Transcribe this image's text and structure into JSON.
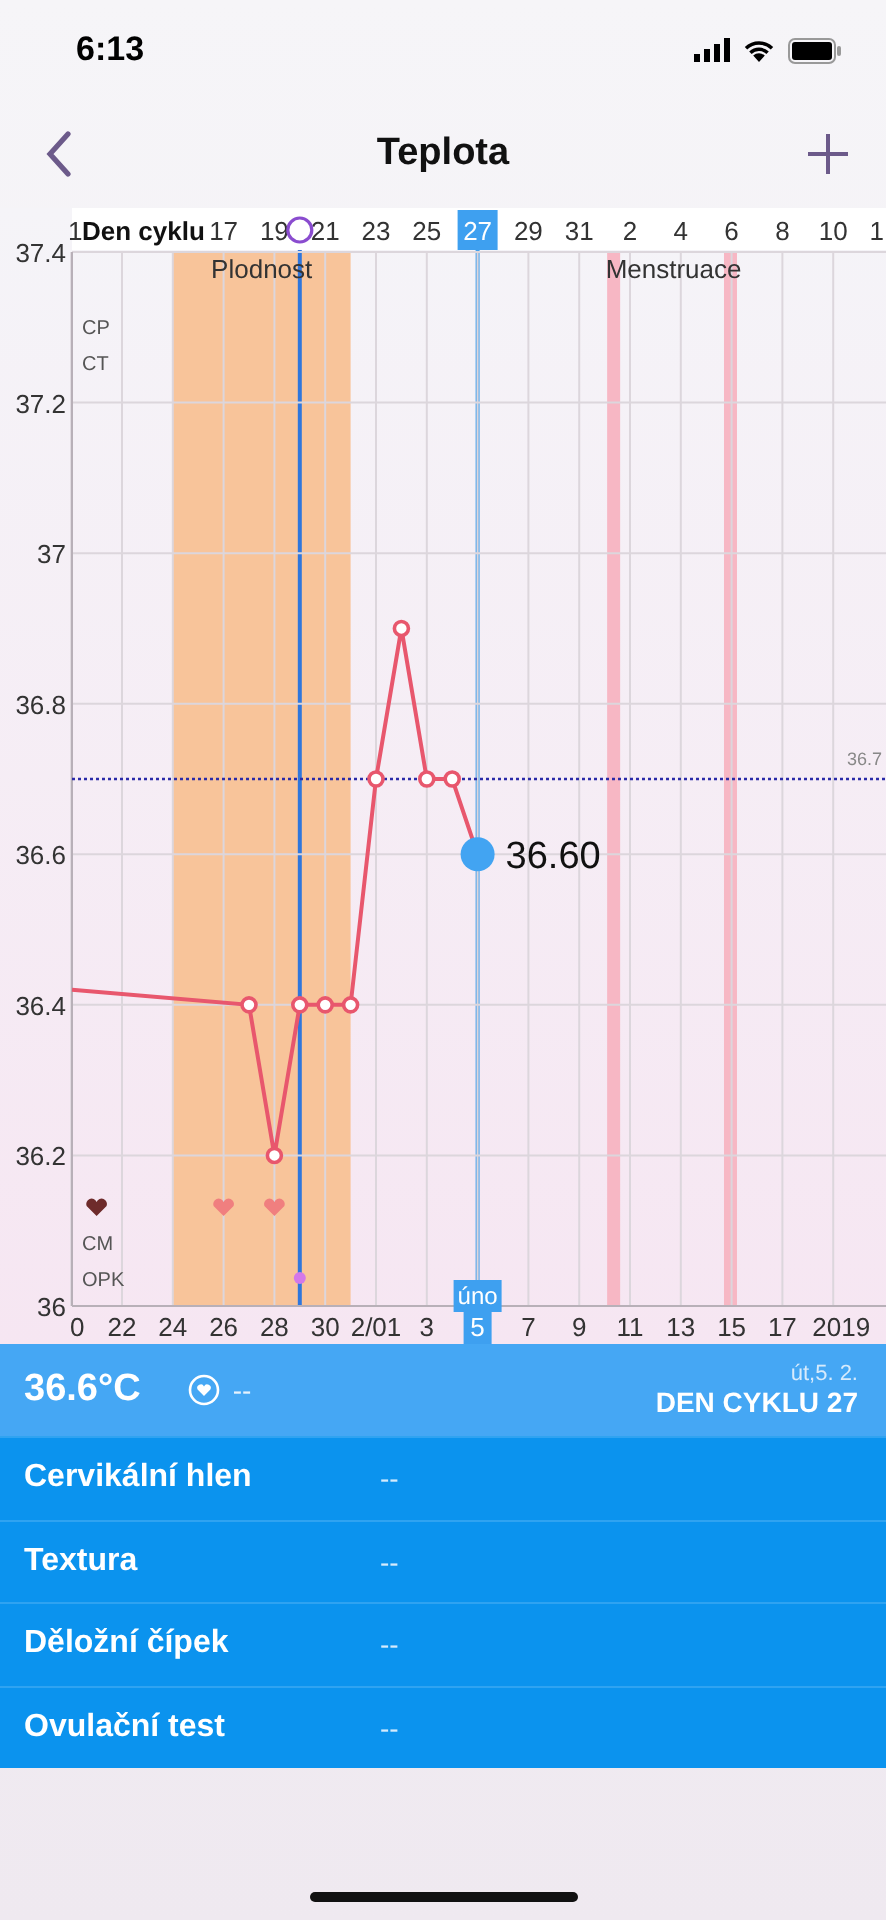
{
  "status_bar": {
    "time": "6:13"
  },
  "nav": {
    "title": "Teplota"
  },
  "chart": {
    "header_label": "Den cyklu",
    "top_labels": [
      {
        "label": "1",
        "selected": false
      },
      {
        "label": "17",
        "selected": false
      },
      {
        "label": "19",
        "selected": false
      },
      {
        "label": "21",
        "selected": false
      },
      {
        "label": "23",
        "selected": false
      },
      {
        "label": "25",
        "selected": false
      },
      {
        "label": "27",
        "selected": true
      },
      {
        "label": "29",
        "selected": false
      },
      {
        "label": "31",
        "selected": false
      },
      {
        "label": "2",
        "selected": false
      },
      {
        "label": "4",
        "selected": false
      },
      {
        "label": "6",
        "selected": false
      },
      {
        "label": "8",
        "selected": false
      },
      {
        "label": "10",
        "selected": false
      },
      {
        "label": "1",
        "selected": false
      }
    ],
    "month_label": "úno",
    "fertile_label": "Plodnost",
    "period_label": "Menstruace",
    "row_labels": [
      "CP",
      "CT",
      "CM",
      "OPK"
    ],
    "hearts": [
      {
        "color": "#6e2b2b"
      },
      {
        "color": "#f07f7f"
      },
      {
        "color": "#f07f7f"
      }
    ],
    "opk_marks": [
      {
        "color": "#d478e8"
      }
    ],
    "selected_reading": "36.60",
    "chart_data": {
      "type": "line",
      "ylim": [
        36,
        37.4
      ],
      "grid": true,
      "ref_lines": [
        {
          "axis": "y",
          "value": 36.7,
          "label": "36.7",
          "color": "#2a2aa8"
        }
      ],
      "yticks": [
        36,
        36.2,
        36.4,
        36.6,
        36.8,
        37,
        37.2,
        37.4
      ],
      "categories": [
        "0",
        null,
        "22",
        null,
        "24",
        null,
        "26",
        null,
        "28",
        null,
        "30",
        null,
        "2/01",
        null,
        "3",
        null,
        "5",
        null,
        "7",
        null,
        "9",
        null,
        "11",
        null,
        "13",
        null,
        "15",
        null,
        "17",
        null,
        "2019"
      ],
      "series": [
        {
          "color": "#e8576d",
          "marker": "o",
          "values": [
            36.42,
            null,
            null,
            null,
            null,
            null,
            null,
            36.4,
            36.2,
            36.4,
            36.4,
            36.4,
            36.7,
            36.9,
            36.7,
            36.7,
            36.6,
            null,
            null,
            null,
            null,
            null,
            null,
            null,
            null,
            null,
            null,
            null,
            null,
            null,
            null
          ]
        }
      ]
    }
  },
  "summary": {
    "temperature": "36.6°C",
    "sex": "--",
    "date": "út,5. 2.",
    "cycle_day": "DEN CYKLU 27"
  },
  "details": [
    {
      "label": "Cervikální hlen",
      "value": "--"
    },
    {
      "label": "Textura",
      "value": "--"
    },
    {
      "label": "Děložní čípek",
      "value": "--"
    },
    {
      "label": "Ovulační test",
      "value": "--"
    }
  ]
}
